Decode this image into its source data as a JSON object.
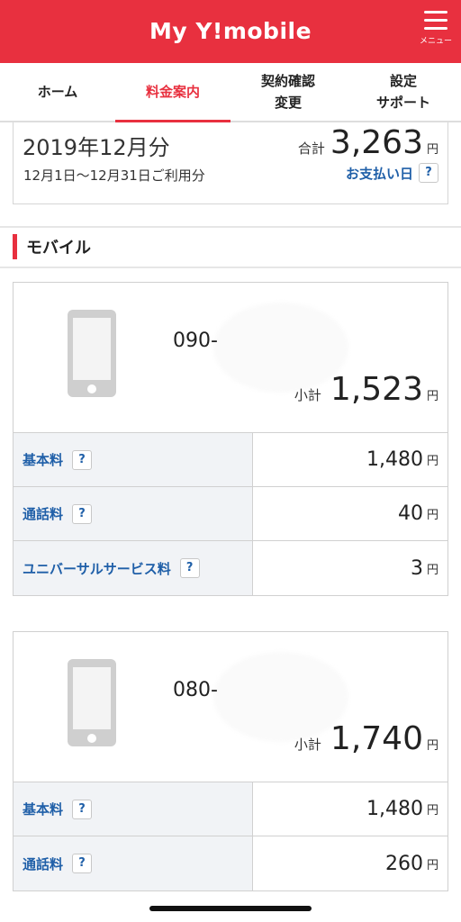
{
  "header": {
    "logo": "My Y!mobile",
    "menu_label": "メニュー"
  },
  "tabs": [
    {
      "label": "ホーム"
    },
    {
      "label": "料金案内"
    },
    {
      "label": "契約確認\n変更"
    },
    {
      "label": "設定\nサポート"
    }
  ],
  "summary": {
    "month": "2019年12月分",
    "period": "12月1日〜12月31日ご利用分",
    "total_label": "合計",
    "total_value": "3,263",
    "currency": "円",
    "pay_link": "お支払い日",
    "help": "?"
  },
  "section": {
    "title": "モバイル"
  },
  "lines": [
    {
      "number_prefix": "090-",
      "subtotal_label": "小計",
      "subtotal_value": "1,523",
      "currency": "円",
      "rows": [
        {
          "label": "基本料",
          "help": "?",
          "value": "1,480",
          "unit": "円"
        },
        {
          "label": "通話料",
          "help": "?",
          "value": "40",
          "unit": "円"
        },
        {
          "label": "ユニバーサルサービス料",
          "help": "?",
          "value": "3",
          "unit": "円"
        }
      ]
    },
    {
      "number_prefix": "080-",
      "subtotal_label": "小計",
      "subtotal_value": "1,740",
      "currency": "円",
      "rows": [
        {
          "label": "基本料",
          "help": "?",
          "value": "1,480",
          "unit": "円"
        },
        {
          "label": "通話料",
          "help": "?",
          "value": "260",
          "unit": "円"
        }
      ]
    }
  ],
  "colors": {
    "brand": "#e8303f",
    "link": "#1f5fa8"
  }
}
